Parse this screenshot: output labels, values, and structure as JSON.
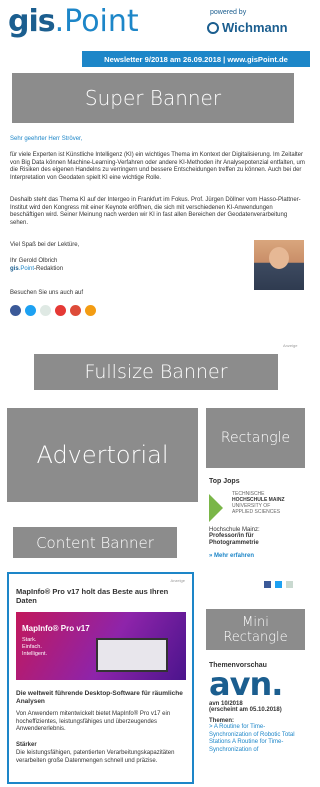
{
  "header": {
    "logo_gis": "gis",
    "logo_dot": ".",
    "logo_point": "Point",
    "powered_by": "powered by",
    "wichmann": "Wichmann",
    "newsletter_bar": "Newsletter 9/2018 am 26.09.2018 | www.gisPoint.de"
  },
  "banners": {
    "super": "Super Banner",
    "fullsize": "Fullsize Banner",
    "advertorial": "Advertorial",
    "rectangle": "Rectangle",
    "content": "Content Banner",
    "mini_rectangle": "Mini Rectangle"
  },
  "letter": {
    "greeting": "Sehr geehrter Herr Ströver,",
    "p1": "für viele Experten ist Künstliche Intelligenz (KI) ein wichtiges Thema im Kontext der Digitalisierung. Im Zeitalter von Big Data können Machine-Learning-Verfahren oder andere KI-Methoden ihr Analysepotenzial entfalten, um die Risiken des eigenen Handelns zu verringern und bessere Entscheidungen treffen zu können. Auch bei der Interpretation von Geodaten spielt KI eine wichtige Rolle.",
    "p2": "Deshalb steht das Thema KI auf der Intergeo in Frankfurt im Fokus. Prof. Jürgen Döllner vom Hasso-Plattner-Institut wird den Kongress mit einer Keynote eröffnen, die sich mit verschiedenen KI-Anwendungen beschäftigen wird. Seiner Meinung nach werden wir KI in fast allen Bereichen der Geodatenverarbeitung sehen.",
    "p3": "Viel Spaß bei der Lektüre,",
    "sign1": "Ihr Gerold Olbrich",
    "sign2_a": "gis",
    "sign2_b": ".Point",
    "sign2_c": "-Redaktion",
    "visit": "Besuchen Sie uns auch auf",
    "anzeige": "Anzeige"
  },
  "topjobs": {
    "title": "Top Jops",
    "school_line1": "TECHNISCHE",
    "school_line2": "HOCHSCHULE MAINZ",
    "school_line3": "UNIVERSITY OF",
    "school_line4": "APPLIED SCIENCES",
    "job1": "Hochschule Mainz:",
    "job2": "Professor/in für Photogrammetrie",
    "more": "» Mehr erfahren"
  },
  "mapinfo": {
    "anzeige": "Anzeige",
    "title": "MapInfo® Pro v17 holt das Beste aus Ihren Daten",
    "banner_title": "MapInfo® Pro v17",
    "banner_l1": "Stark.",
    "banner_l2": "Einfach.",
    "banner_l3": "Intelligent.",
    "subtitle": "Die weltweit führende Desktop-Software für räumliche Analysen",
    "body": "Von Anwendern mitentwickelt bietet MapInfo® Pro v17 ein hocheffizientes, leistungsfähiges und überzeugendes Anwendererlebnis.",
    "starker": "Stärker",
    "starker_body": "Die leistungsfähigen, patentierten Verarbeitungskapazitäten verarbeiten große Datenmengen schnell und präzise."
  },
  "themen": {
    "title": "Themenvorschau",
    "logo": "avn.",
    "issue1": "avn 10/2018",
    "issue2": "(erscheint am 05.10.2018)",
    "themen_label": "Themen:",
    "item1": "> A Routine for Time-Synchronization of Robotic Total Stations A Routine for Time-Synchronization of"
  },
  "colors": {
    "brand_blue": "#1d86c8",
    "dark_blue": "#1b5e8f",
    "gray": "#8c8c8c",
    "green": "#7ab648"
  }
}
